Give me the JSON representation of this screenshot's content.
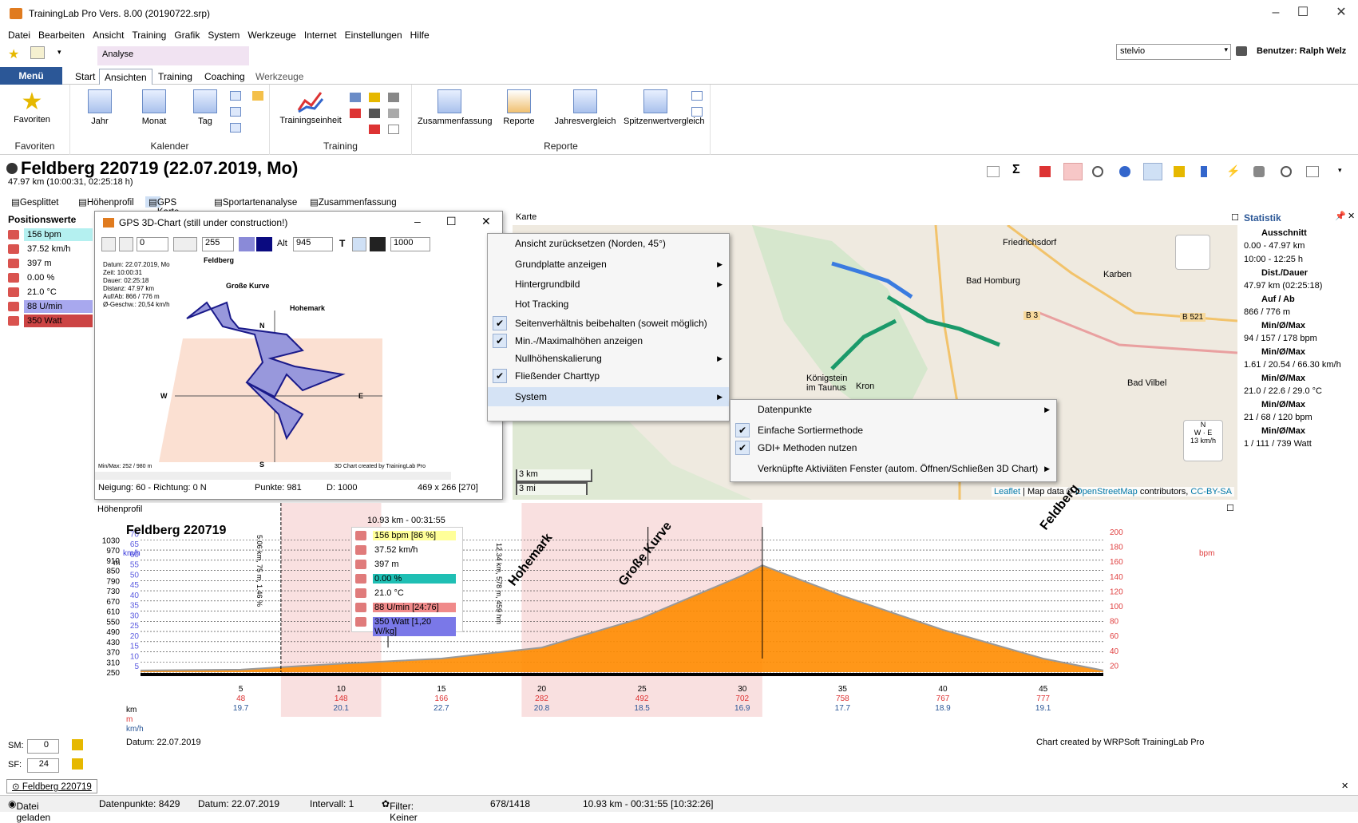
{
  "window": {
    "title": "TrainingLab Pro Vers. 8.00 (20190722.srp)",
    "controls": [
      "–",
      "☐",
      "✕"
    ]
  },
  "menubar": [
    "Datei",
    "Bearbeiten",
    "Ansicht",
    "Training",
    "Grafik",
    "System",
    "Werkzeuge",
    "Internet",
    "Einstellungen",
    "Hilfe"
  ],
  "ribbon": {
    "context_tab": "Analyse",
    "menu_button": "Menü",
    "tabs": [
      "Start",
      "Ansichten",
      "Training",
      "Coaching",
      "Werkzeuge"
    ],
    "user_select": "stelvio",
    "user_label": "Benutzer: Ralph Welz",
    "groups": {
      "favoriten": {
        "label": "Favoriten",
        "button": "Favoriten"
      },
      "kalender": {
        "label": "Kalender",
        "buttons": [
          "Jahr",
          "Monat",
          "Tag"
        ]
      },
      "training": {
        "label": "Training",
        "button": "Trainingseinheit"
      },
      "reporte": {
        "label": "Reporte",
        "buttons": [
          "Zusammenfassung",
          "Reporte",
          "Jahresvergleich",
          "Spitzenwertvergleich"
        ]
      }
    }
  },
  "activity": {
    "title": "Feldberg 220719 (22.07.2019, Mo)",
    "subtitle": "47.97 km (10:00:31, 02:25:18 h)"
  },
  "subtabs": [
    "Gesplittet",
    "Höhenprofil",
    "GPS Karte",
    "Sportartenanalyse",
    "Zusammenfassung"
  ],
  "positionswerte": {
    "title": "Positionswerte",
    "rows": [
      {
        "icon": "heart-icon",
        "value": "156 bpm",
        "bg": "#b4f0f0"
      },
      {
        "icon": "speedometer-icon",
        "value": "37.52 km/h",
        "bg": ""
      },
      {
        "icon": "mountain-icon",
        "value": "397 m",
        "bg": ""
      },
      {
        "icon": "slope-icon",
        "value": "0.00 %",
        "bg": ""
      },
      {
        "icon": "thermometer-icon",
        "value": "21.0 °C",
        "bg": ""
      },
      {
        "icon": "cadence-icon",
        "value": "88 U/min",
        "bg": "#a8a8ee"
      },
      {
        "icon": "power-icon",
        "value": "350 Watt",
        "bg": "#cc4444"
      }
    ],
    "sm_label": "SM:",
    "sm_value": "0",
    "sf_label": "SF:",
    "sf_value": "24"
  },
  "gps3d": {
    "title": "GPS 3D-Chart (still under construction!)",
    "toolbar": {
      "field1": "0",
      "field2": "255",
      "alt_label": "Alt",
      "alt_value": "945",
      "t_label": "T",
      "field3": "1000"
    },
    "info": [
      "Datum: 22.07.2019, Mo",
      "Zeit: 10:00:31",
      "Dauer: 02:25:18",
      "Distanz: 47.97 km",
      "Auf/Ab: 866 / 776 m",
      "Ø-Geschw.: 20,54 km/h"
    ],
    "labels": {
      "feldberg": "Feldberg",
      "kurve": "Große Kurve",
      "hohemark": "Hohemark",
      "n": "N",
      "s": "S",
      "w": "W",
      "e": "E"
    },
    "minmax": "Min/Max: 252 / 980 m",
    "credit": "3D Chart created by TrainingLab Pro",
    "status": {
      "neigung": "Neigung: 60 - Richtung: 0 N",
      "punkte": "Punkte: 981",
      "d": "D: 1000",
      "size": "469 x 266 [270]"
    }
  },
  "map": {
    "header": "Karte",
    "places": [
      "Friedrichsdorf",
      "Bad Homburg",
      "Karben",
      "Bad Vilbel",
      "Königstein im Taunus",
      "Kron",
      "B 3",
      "B 521"
    ],
    "scale_km": "3 km",
    "scale_mi": "3 mi",
    "attribution_leaflet": "Leaflet",
    "attribution_text": "| Map data ©",
    "attribution_osm": "OpenStreetMap",
    "attribution_rest": "contributors,",
    "attribution_license": "CC-BY-SA",
    "compass_speed": "13 km/h",
    "compass_n": "N",
    "compass_w": "W",
    "compass_e": "E"
  },
  "context_menu": {
    "items": [
      {
        "label": "Ansicht zurücksetzen (Norden, 45°)",
        "check": false,
        "arrow": false
      },
      {
        "label": "Grundplatte anzeigen",
        "check": false,
        "arrow": true
      },
      {
        "label": "Hintergrundbild",
        "check": false,
        "arrow": true
      },
      {
        "label": "Hot Tracking",
        "check": false,
        "arrow": false
      },
      {
        "label": "Seitenverhältnis beibehalten (soweit möglich)",
        "check": true,
        "arrow": false
      },
      {
        "label": "Min.-/Maximalhöhen anzeigen",
        "check": true,
        "arrow": false
      },
      {
        "label": "Nullhöhenskalierung",
        "check": false,
        "arrow": true
      },
      {
        "label": "Fließender Charttyp",
        "check": true,
        "arrow": false
      },
      {
        "label": "System",
        "check": false,
        "arrow": true
      }
    ]
  },
  "submenu": {
    "items": [
      {
        "label": "Datenpunkte",
        "check": false,
        "arrow": true
      },
      {
        "label": "Einfache Sortiermethode",
        "check": true,
        "arrow": false
      },
      {
        "label": "GDI+ Methoden nutzen",
        "check": true,
        "arrow": false
      },
      {
        "label": "Verknüpfte Aktiviäten Fenster (autom. Öffnen/Schließen 3D Chart)",
        "check": false,
        "arrow": true
      }
    ]
  },
  "statistik": {
    "title": "Statistik",
    "rows": [
      {
        "text": "Ausschnitt",
        "bold": true
      },
      {
        "text": "0.00 - 47.97 km",
        "bold": false
      },
      {
        "text": "10:00 - 12:25 h",
        "bold": false
      },
      {
        "text": "Dist./Dauer",
        "bold": true
      },
      {
        "text": "47.97 km (02:25:18)",
        "bold": false
      },
      {
        "text": "Auf / Ab",
        "bold": true
      },
      {
        "text": "866 / 776 m",
        "bold": false
      },
      {
        "text": "Min/Ø/Max",
        "bold": true
      },
      {
        "text": "94 / 157 / 178 bpm",
        "bold": false
      },
      {
        "text": "Min/Ø/Max",
        "bold": true
      },
      {
        "text": "1.61 / 20.54 / 66.30 km/h",
        "bold": false
      },
      {
        "text": "Min/Ø/Max",
        "bold": true
      },
      {
        "text": "21.0 / 22.6 / 29.0 °C",
        "bold": false
      },
      {
        "text": "Min/Ø/Max",
        "bold": true
      },
      {
        "text": "21 / 68 / 120 bpm",
        "bold": false
      },
      {
        "text": "Min/Ø/Max",
        "bold": true
      },
      {
        "text": "1 / 111 / 739 Watt",
        "bold": false
      }
    ]
  },
  "hoehenprofil": {
    "header": "Höhenprofil",
    "chart_title": "Feldberg 220719",
    "cursor_label": "10.93 km - 00:31:55",
    "tooltip": [
      {
        "icon": "heart-icon",
        "text": "156 bpm [86 %]",
        "bg": "#ffff99"
      },
      {
        "icon": "speedometer-icon",
        "text": "37.52 km/h",
        "bg": ""
      },
      {
        "icon": "mountain-icon",
        "text": "397 m",
        "bg": ""
      },
      {
        "icon": "slope-icon",
        "text": "0.00 %",
        "bg": "#1fbfb4"
      },
      {
        "icon": "thermometer-icon",
        "text": "21.0 °C",
        "bg": ""
      },
      {
        "icon": "cadence-icon",
        "text": "88 U/min [24:76]",
        "bg": "#f08a8a"
      },
      {
        "icon": "power-icon",
        "text": "350 Watt [1,20 W/kg]",
        "bg": "#7a78e8"
      }
    ],
    "markers": [
      {
        "label": "Hohemark",
        "vlabel": "12.34 km, 578 m, 459 hm"
      },
      {
        "label": "Große Kurve",
        "vlabel": ""
      },
      {
        "label": "Feldberg",
        "vlabel": ""
      },
      {
        "label": "",
        "vlabel": "5.06 km, 75 m, 1.46 %"
      }
    ],
    "axis_left_units": [
      "km/h",
      "m"
    ],
    "axis_right_unit": "bpm",
    "y_left_m": [
      "1030",
      "970",
      "910",
      "850",
      "790",
      "730",
      "670",
      "610",
      "550",
      "490",
      "430",
      "370",
      "310",
      "250"
    ],
    "y_left_kmh": [
      "70",
      "65",
      "60",
      "55",
      "50",
      "45",
      "40",
      "35",
      "30",
      "25",
      "20",
      "15",
      "10",
      "5"
    ],
    "y_right_bpm": [
      "200",
      "180",
      "160",
      "140",
      "120",
      "100",
      "80",
      "60",
      "40",
      "20"
    ],
    "x_row_labels": [
      "km",
      "m",
      "km/h"
    ],
    "x_km": [
      "5",
      "10",
      "15",
      "20",
      "25",
      "30",
      "35",
      "40",
      "45"
    ],
    "x_m": [
      "48",
      "148",
      "166",
      "282",
      "492",
      "702",
      "758",
      "767",
      "777"
    ],
    "x_kmh": [
      "19.7",
      "20.1",
      "22.7",
      "20.8",
      "18.5",
      "16.9",
      "17.7",
      "18.9",
      "19.1"
    ],
    "date": "Datum: 22.07.2019",
    "credit": "Chart created by WRPSoft TrainingLab Pro"
  },
  "chart_data": {
    "type": "area",
    "title": "Feldberg 220719",
    "xlabel": "km",
    "ylabel": "m",
    "x": [
      0,
      5,
      10,
      15,
      20,
      25,
      30,
      31,
      35,
      40,
      45,
      48
    ],
    "series": [
      {
        "name": "",
        "values": [
          260,
          265,
          300,
          330,
          395,
          570,
          820,
          880,
          700,
          500,
          330,
          260
        ]
      }
    ],
    "ylim": [
      250,
      1060
    ],
    "y2lim": [
      0,
      200
    ],
    "xlim": [
      0,
      48
    ]
  },
  "bottom_tab": "Feldberg 220719",
  "statusbar": {
    "loaded": "Datei geladen",
    "datenpunkte": "Datenpunkte: 8429",
    "datum": "Datum: 22.07.2019",
    "intervall": "Intervall: 1",
    "filter": "Filter: Keiner",
    "index": "678/1418",
    "pos": "10.93 km - 00:31:55 [10:32:26]"
  },
  "colors": {
    "menu_blue": "#2b5797",
    "elevation_fill": "#ff8c00",
    "hr_line": "#e04040",
    "speed_line": "#3a3adc",
    "region_pink": "#f4c6c6"
  }
}
